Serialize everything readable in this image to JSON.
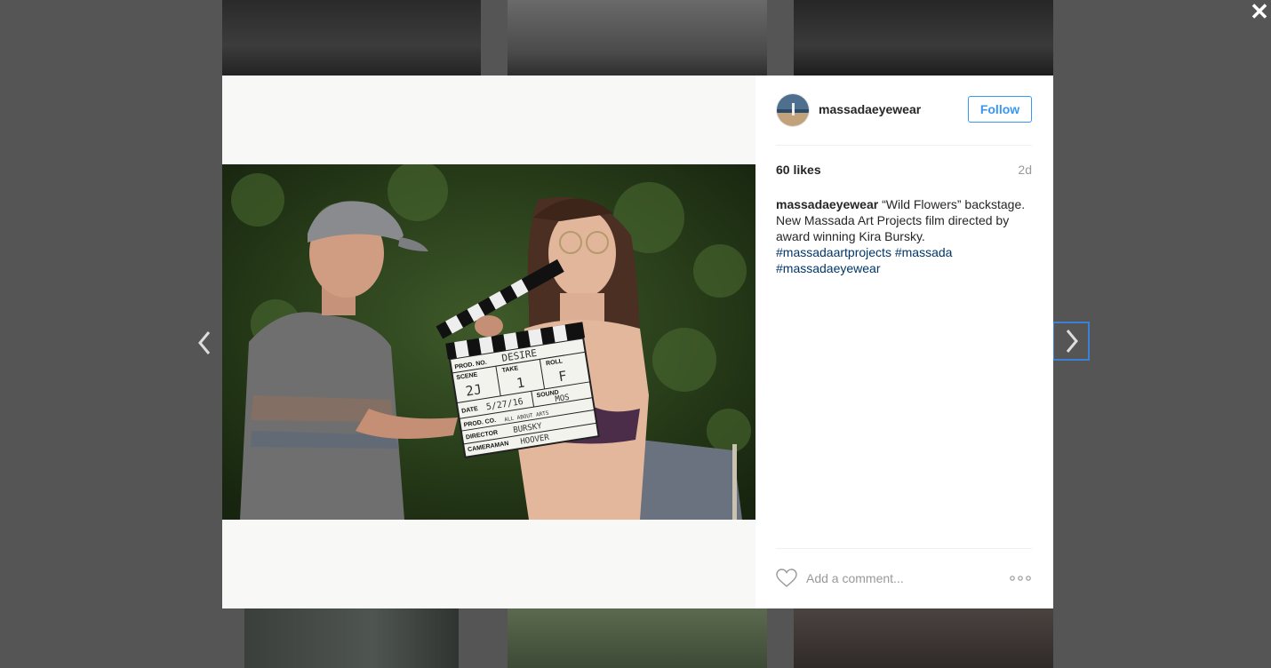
{
  "post": {
    "username": "massadaeyewear",
    "follow_label": "Follow",
    "likes": "60 likes",
    "age": "2d",
    "caption_user": "massadaeyewear",
    "caption_text": " “Wild Flowers” backstage. New Massada Art Projects film directed by award winning Kira Bursky. ",
    "hashtags": [
      "#massadaartprojects",
      "#massada",
      "#massadaeyewear"
    ]
  },
  "comment": {
    "placeholder": "Add a comment..."
  },
  "clapperboard": {
    "prod_no_label": "PROD. NO.",
    "prod_no": "DESIRE",
    "scene_label": "SCENE",
    "scene": "2J",
    "take_label": "TAKE",
    "take": "1",
    "roll_label": "ROLL",
    "roll": "F",
    "date_label": "DATE",
    "date": "5/27/16",
    "sound_label": "SOUND",
    "sound": "MOS",
    "prod_co_label": "PROD. CO.",
    "prod_co": "ALL ABOUT ARTS",
    "director_label": "DIRECTOR",
    "director": "BURSKY",
    "cameraman_label": "CAMERAMAN",
    "cameraman": "HOOVER"
  },
  "colors": {
    "accent": "#3897f0",
    "hashtag": "#003569",
    "overlay": "#555555"
  },
  "icons": [
    "close-icon",
    "chevron-left-icon",
    "chevron-right-icon",
    "heart-icon",
    "more-options-icon"
  ]
}
